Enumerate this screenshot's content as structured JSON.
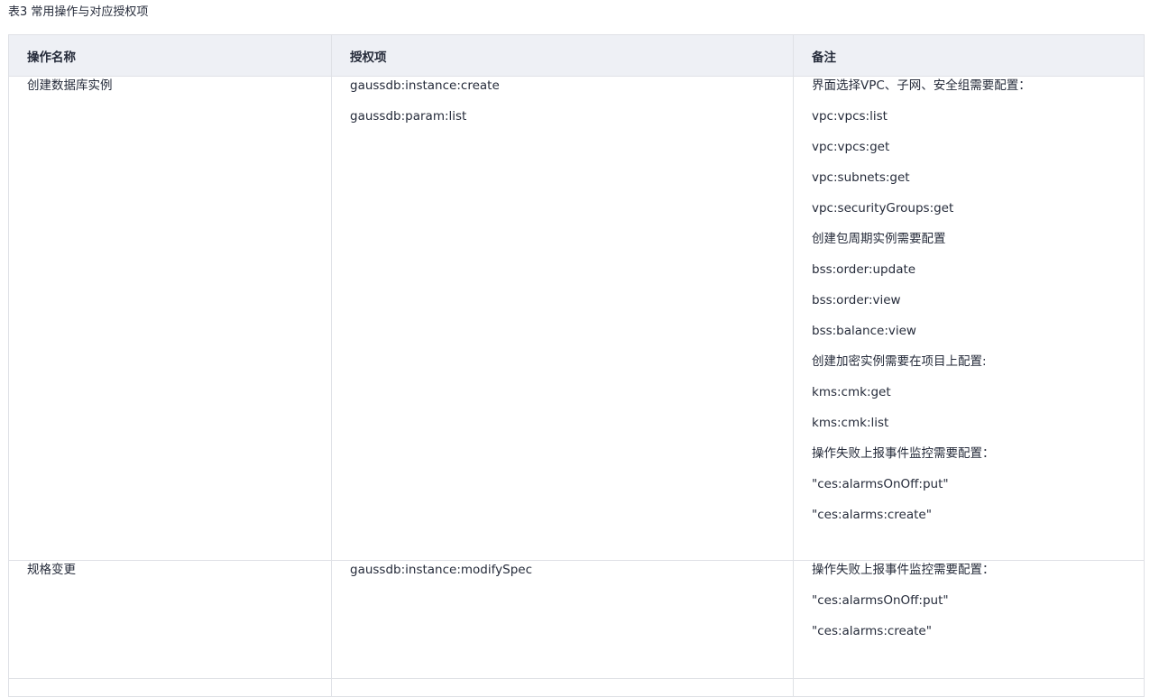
{
  "caption": "表3 常用操作与对应授权项",
  "table": {
    "headers": [
      "操作名称",
      "授权项",
      "备注"
    ],
    "rows": [
      {
        "operation": "创建数据库实例",
        "permissions": [
          "gaussdb:instance:create",
          "gaussdb:param:list"
        ],
        "notes": [
          "界面选择VPC、子网、安全组需要配置：",
          "vpc:vpcs:list",
          "vpc:vpcs:get",
          "vpc:subnets:get",
          "vpc:securityGroups:get",
          "创建包周期实例需要配置",
          "bss:order:update",
          "bss:order:view",
          "bss:balance:view",
          "创建加密实例需要在项目上配置:",
          "kms:cmk:get",
          "kms:cmk:list",
          "操作失败上报事件监控需要配置：",
          "\"ces:alarmsOnOff:put\"",
          "\"ces:alarms:create\""
        ]
      },
      {
        "operation": "规格变更",
        "permissions": [
          "gaussdb:instance:modifySpec"
        ],
        "notes": [
          "操作失败上报事件监控需要配置：",
          "\"ces:alarmsOnOff:put\"",
          "\"ces:alarms:create\""
        ]
      }
    ]
  }
}
